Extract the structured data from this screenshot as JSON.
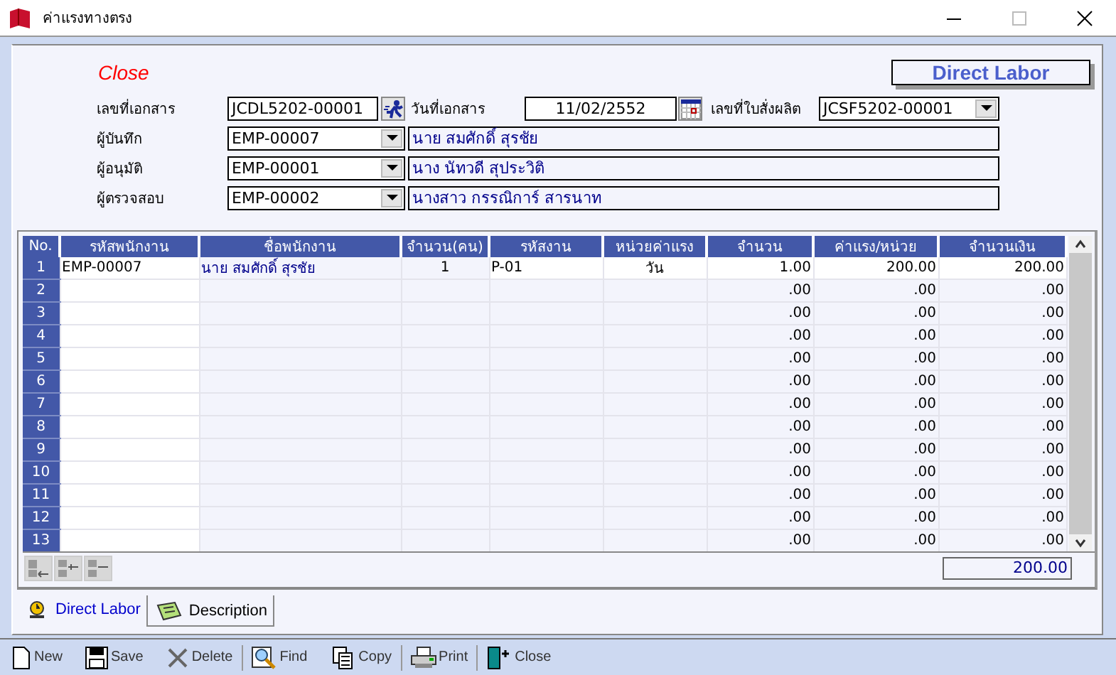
{
  "window": {
    "title": "ค่าแรงทางตรง"
  },
  "status": "Close",
  "form_title": "Direct Labor",
  "doc": {
    "label": "เลขที่เอกสาร",
    "value": "JCDL5202-00001",
    "date_label": "วันที่เอกสาร",
    "date": "11/02/2552",
    "order_label": "เลขที่ใบสั่งผลิต",
    "order": "JCSF5202-00001"
  },
  "people": [
    {
      "label": "ผู้บันทึก",
      "code": "EMP-00007",
      "name": "นาย สมศักดิ์  สุรชัย"
    },
    {
      "label": "ผู้อนุมัติ",
      "code": "EMP-00001",
      "name": "นาง นัทวดี สุประวิติ"
    },
    {
      "label": "ผู้ตรวจสอบ",
      "code": "EMP-00002",
      "name": "นางสาว กรรณิการ์ สารนาท"
    }
  ],
  "table": {
    "columns": [
      "No.",
      "รหัสพนักงาน",
      "ชื่อพนักงาน",
      "จำนวน(คน)",
      "รหัสงาน",
      "หน่วยค่าแรง",
      "จำนวน",
      "ค่าแรง/หน่วย",
      "จำนวนเงิน"
    ],
    "rows": [
      {
        "no": "1",
        "emp_code": "EMP-00007",
        "emp_name": "นาย สมศักดิ์  สุรชัย",
        "people": "1",
        "task": "P-01",
        "unit": "วัน",
        "qty": "1.00",
        "rate": "200.00",
        "amount": "200.00"
      },
      {
        "no": "2",
        "qty": ".00",
        "rate": ".00",
        "amount": ".00"
      },
      {
        "no": "3",
        "qty": ".00",
        "rate": ".00",
        "amount": ".00"
      },
      {
        "no": "4",
        "qty": ".00",
        "rate": ".00",
        "amount": ".00"
      },
      {
        "no": "5",
        "qty": ".00",
        "rate": ".00",
        "amount": ".00"
      },
      {
        "no": "6",
        "qty": ".00",
        "rate": ".00",
        "amount": ".00"
      },
      {
        "no": "7",
        "qty": ".00",
        "rate": ".00",
        "amount": ".00"
      },
      {
        "no": "8",
        "qty": ".00",
        "rate": ".00",
        "amount": ".00"
      },
      {
        "no": "9",
        "qty": ".00",
        "rate": ".00",
        "amount": ".00"
      },
      {
        "no": "10",
        "qty": ".00",
        "rate": ".00",
        "amount": ".00"
      },
      {
        "no": "11",
        "qty": ".00",
        "rate": ".00",
        "amount": ".00"
      },
      {
        "no": "12",
        "qty": ".00",
        "rate": ".00",
        "amount": ".00"
      },
      {
        "no": "13",
        "qty": ".00",
        "rate": ".00",
        "amount": ".00"
      }
    ]
  },
  "total": "200.00",
  "tabs": [
    {
      "label": "Direct Labor",
      "kind": "labor",
      "selected": true
    },
    {
      "label": "Description",
      "kind": "note",
      "selected": false
    }
  ],
  "toolbar": [
    {
      "label": "New",
      "kind": "new"
    },
    {
      "label": "Save",
      "kind": "save"
    },
    {
      "label": "Delete",
      "kind": "delete"
    },
    {
      "label": "Find",
      "kind": "find"
    },
    {
      "label": "Copy",
      "kind": "copy"
    },
    {
      "label": "Print",
      "kind": "print"
    },
    {
      "label": "Close",
      "kind": "exit"
    }
  ]
}
